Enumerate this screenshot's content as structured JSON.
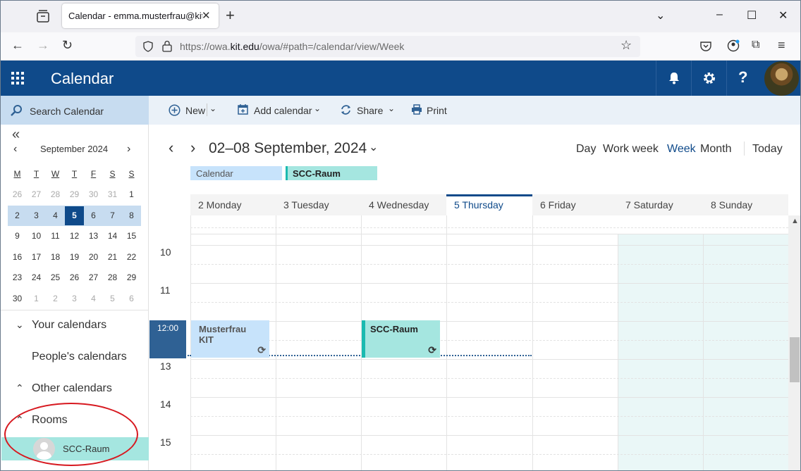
{
  "browser": {
    "tab_title": "Calendar - emma.musterfrau@kit.edu",
    "tab_close": "✕",
    "new_tab": "+",
    "window_controls": [
      "⌄",
      "–",
      "☐",
      "✕"
    ],
    "url_prefix": "https://owa.",
    "url_domain": "kit.edu",
    "url_suffix": "/owa/#path=/calendar/view/Week"
  },
  "header": {
    "app_title": "Calendar",
    "icons": [
      "bell-icon",
      "gear-icon",
      "help-icon",
      "avatar"
    ],
    "help_label": "?"
  },
  "search": {
    "label": "Search Calendar"
  },
  "toolbar": {
    "new_label": "New",
    "add_calendar_label": "Add calendar",
    "share_label": "Share",
    "print_label": "Print"
  },
  "mini_calendar": {
    "collapse_label": "«",
    "month_label": "September 2024",
    "weekday_headers": [
      "M",
      "T",
      "W",
      "T",
      "F",
      "S",
      "S"
    ],
    "weeks": [
      [
        "26",
        "27",
        "28",
        "29",
        "30",
        "31",
        "1"
      ],
      [
        "2",
        "3",
        "4",
        "5",
        "6",
        "7",
        "8"
      ],
      [
        "9",
        "10",
        "11",
        "12",
        "13",
        "14",
        "15"
      ],
      [
        "16",
        "17",
        "18",
        "19",
        "20",
        "21",
        "22"
      ],
      [
        "23",
        "24",
        "25",
        "26",
        "27",
        "28",
        "29"
      ],
      [
        "30",
        "1",
        "2",
        "3",
        "4",
        "5",
        "6"
      ]
    ],
    "today": "5"
  },
  "left_nav": {
    "your_calendars": "Your calendars",
    "peoples_calendars": "People's calendars",
    "other_calendars": "Other calendars",
    "rooms": "Rooms",
    "room_item": "SCC-Raum"
  },
  "main": {
    "date_range": "02–08 September, 2024",
    "views": [
      "Day",
      "Work week",
      "Week",
      "Month",
      "Today"
    ],
    "active_view": "Week",
    "legend": [
      "Calendar",
      "SCC-Raum"
    ],
    "days": [
      "2 Monday",
      "3 Tuesday",
      "4 Wednesday",
      "5 Thursday",
      "6 Friday",
      "7 Saturday",
      "8 Sunday"
    ],
    "today_index": 3,
    "hours": [
      "10",
      "11",
      "13",
      "14",
      "15"
    ],
    "current_time": "12:00",
    "events": [
      {
        "title": "Musterfrau KIT",
        "day": "2 Monday",
        "color": "#c7e3fb"
      },
      {
        "title": "SCC-Raum",
        "day": "4 Wednesday",
        "color": "#a5e6e0"
      }
    ]
  },
  "colors": {
    "brand": "#0f4a8a",
    "selection": "#c7dcf0",
    "room": "#a5e6e0",
    "annotation": "#d71920"
  }
}
